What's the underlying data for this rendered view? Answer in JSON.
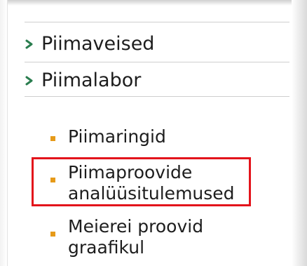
{
  "menu": {
    "items": [
      {
        "label": "Piimaveised"
      },
      {
        "label": "Piimalabor"
      }
    ],
    "subitems": [
      {
        "label_line1": "Piimaringid",
        "label_line2": ""
      },
      {
        "label_line1": "Piimaproovide",
        "label_line2": "analüüsitulemused"
      },
      {
        "label_line1": "Meierei proovid",
        "label_line2": "graafikul"
      }
    ]
  },
  "colors": {
    "chevron": "#2a7d4f",
    "bullet": "#e69a19",
    "highlight": "#e3141b"
  },
  "icons": {
    "chevron": "chevron-right-icon",
    "bullet": "square-bullet-icon"
  }
}
